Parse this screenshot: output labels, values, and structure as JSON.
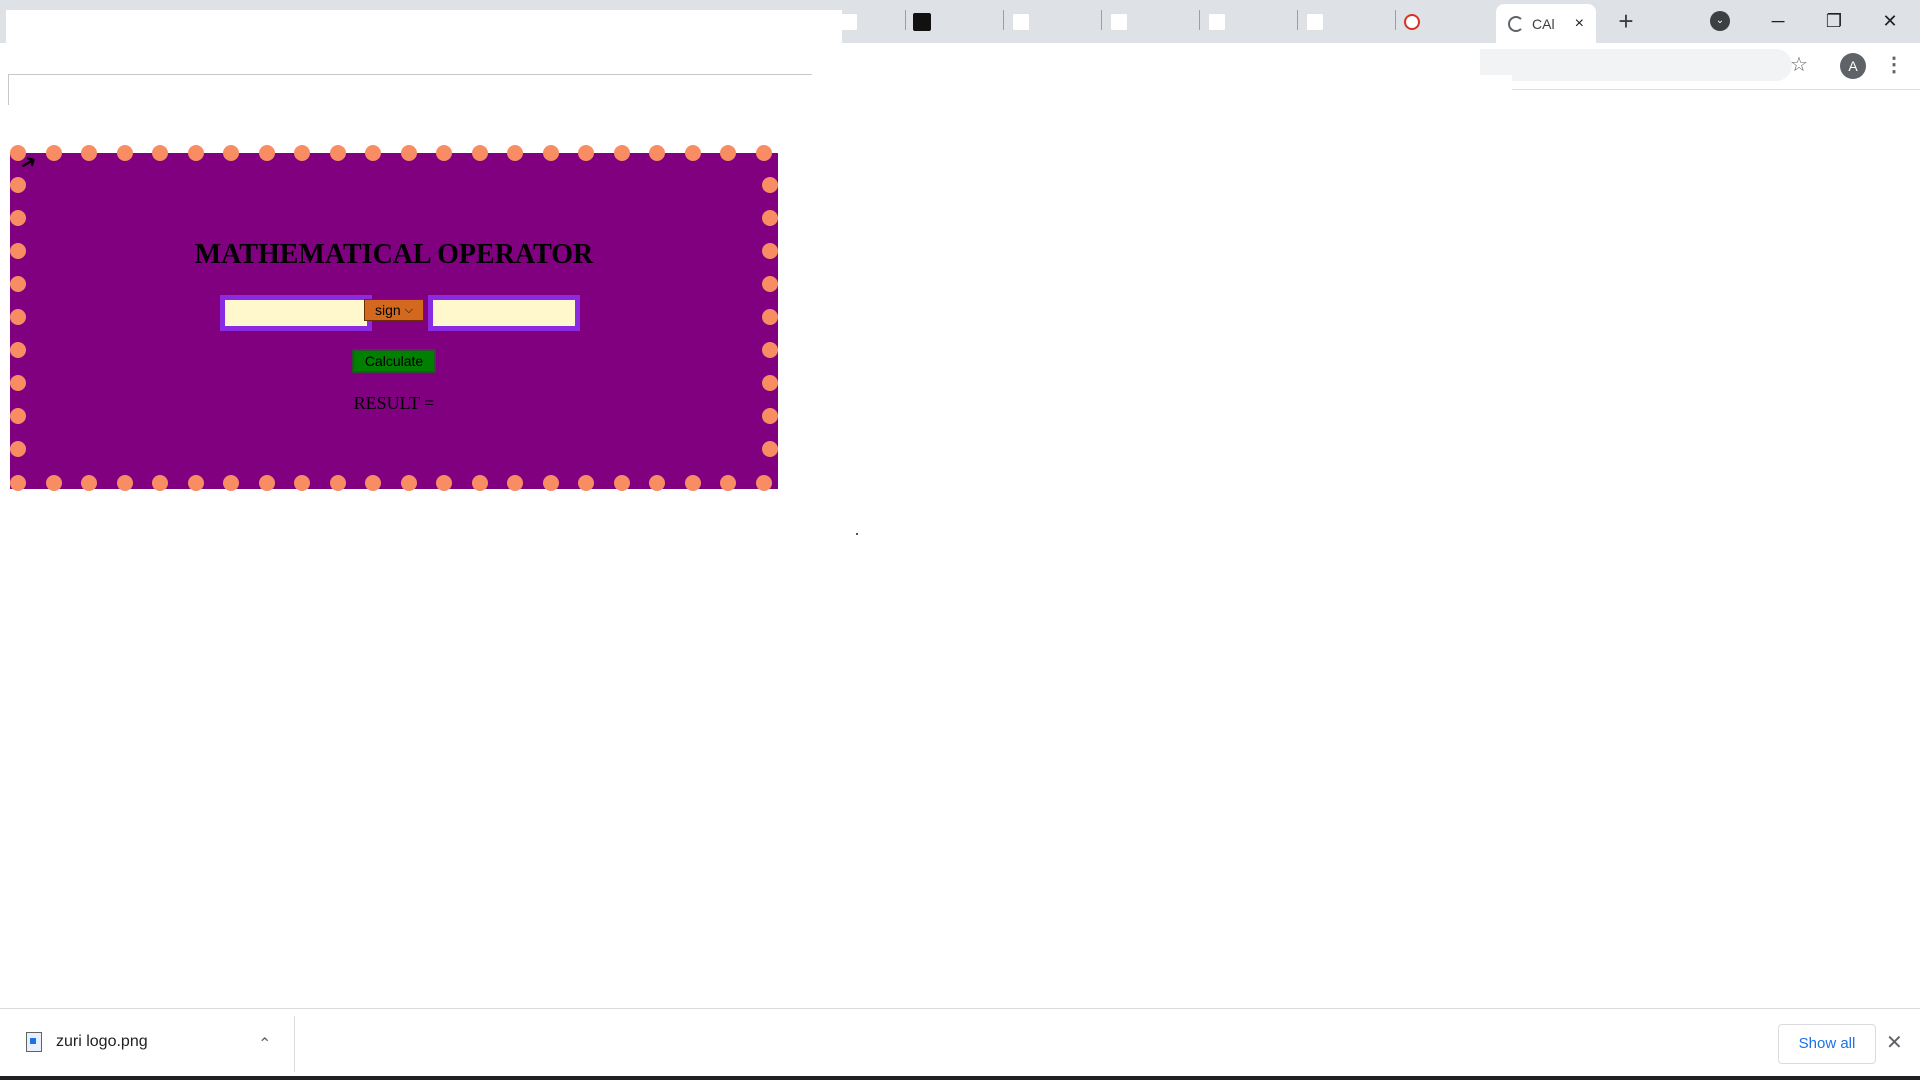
{
  "browser": {
    "active_tab_title": "CAl",
    "tab_close_icon": "×",
    "new_tab_icon": "+",
    "tab_search_icon": "⌄",
    "minimize_icon": "─",
    "restore_icon": "❐",
    "close_window_icon": "✕",
    "bookmark_icon": "☆",
    "profile_initial": "A",
    "menu_icon": "⋮"
  },
  "page": {
    "title": "MATHEMATICAL OPERATOR",
    "first_operand_value": "",
    "second_operand_value": "",
    "sign_selected": "sign",
    "calculate_label": "Calculate",
    "result_label": "RESULT ="
  },
  "colors": {
    "box_background": "#800080",
    "dot_color": "#f88d63",
    "input_background": "#fff8cc",
    "input_border": "#8a2be2",
    "select_background": "#d2691e",
    "button_background": "#008000"
  },
  "downloads": {
    "file_name": "zuri logo.png",
    "caret_icon": "⌃",
    "show_all_label": "Show all",
    "close_icon": "✕"
  }
}
